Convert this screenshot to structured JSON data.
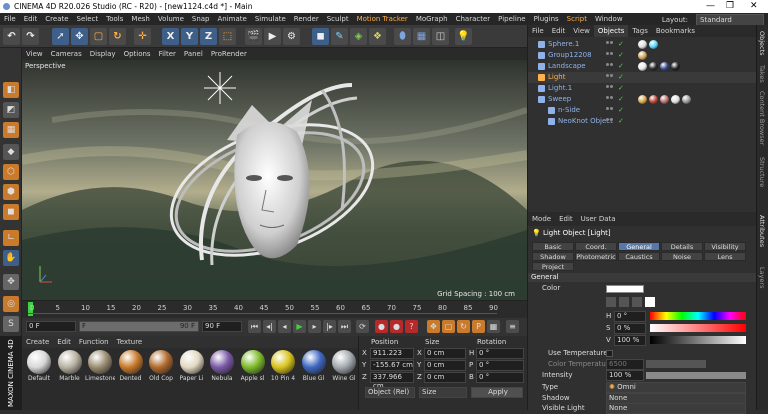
{
  "window": {
    "title": "CINEMA 4D R20.026 Studio (RC - R20) - [new1124.c4d *] - Main",
    "controls": [
      "—",
      "❐",
      "✕"
    ]
  },
  "menubar": {
    "items": [
      "File",
      "Edit",
      "Create",
      "Select",
      "Tools",
      "Mesh",
      "Volume",
      "Snap",
      "Animate",
      "Simulate",
      "Render",
      "Sculpt",
      "Motion Tracker",
      "MoGraph",
      "Character",
      "Pipeline",
      "Plugins",
      "Script",
      "Window"
    ],
    "highlighted": [
      "Motion Tracker",
      "Script"
    ],
    "layout_label": "Layout:",
    "layout_value": "Standard"
  },
  "toolbar": {
    "buttons": [
      "undo-icon",
      "redo-icon",
      "select-icon",
      "move-icon",
      "scale-icon",
      "rotate-icon",
      "cross-icon",
      "x-axis",
      "y-axis",
      "z-axis",
      "coord-icon",
      "render-view-icon",
      "render-icon",
      "render-settings-icon",
      "cube-icon",
      "pen-icon",
      "subdivision-icon",
      "array-icon",
      "deformer-icon",
      "scene-icon",
      "camera-icon",
      "light-icon"
    ],
    "axis_labels": [
      "X",
      "Y",
      "Z"
    ]
  },
  "viewport": {
    "menu": [
      "View",
      "Cameras",
      "Display",
      "Options",
      "Filter",
      "Panel",
      "ProRender"
    ],
    "camera": "Perspective",
    "grid_spacing": "Grid Spacing : 100 cm"
  },
  "timeline": {
    "ticks": [
      "0",
      "5",
      "10",
      "15",
      "20",
      "25",
      "30",
      "35",
      "40",
      "45",
      "50",
      "55",
      "60",
      "65",
      "70",
      "75",
      "80",
      "85",
      "90"
    ]
  },
  "transport": {
    "start_frame": "0 F",
    "current_frame": "F",
    "end_frame": "90 F",
    "max_frame": "90 F"
  },
  "materials": {
    "menu": [
      "Create",
      "Edit",
      "Function",
      "Texture"
    ],
    "items": [
      {
        "label": "Default",
        "color": "#d8d8d8"
      },
      {
        "label": "Marble",
        "color": "#b9b2a3"
      },
      {
        "label": "Limestone",
        "color": "#9b8d73"
      },
      {
        "label": "Dented",
        "color": "#c77a2a"
      },
      {
        "label": "Old Cop",
        "color": "#b06a2e"
      },
      {
        "label": "Paper Li",
        "color": "#e3d9c2"
      },
      {
        "label": "Nebula",
        "color": "#7b5aa6"
      },
      {
        "label": "Apple sl",
        "color": "#7dbb2a"
      },
      {
        "label": "10 Pin 4",
        "color": "#d8c31c"
      },
      {
        "label": "Blue Gl",
        "color": "#3f67c3"
      },
      {
        "label": "Wine Gl",
        "color": "#a4aab0"
      }
    ],
    "brand": "MAXON CINEMA 4D"
  },
  "coordinates": {
    "headers": [
      "Position",
      "Size",
      "Rotation"
    ],
    "rows": [
      {
        "axis": "X",
        "pos": "911.223 cm",
        "size_axis": "X",
        "size": "0 cm",
        "rot_axis": "H",
        "rot": "0 °"
      },
      {
        "axis": "Y",
        "pos": "-155.67 cm",
        "size_axis": "Y",
        "size": "0 cm",
        "rot_axis": "P",
        "rot": "0 °"
      },
      {
        "axis": "Z",
        "pos": "337.966 cm",
        "size_axis": "Z",
        "size": "0 cm",
        "rot_axis": "B",
        "rot": "0 °"
      }
    ],
    "mode": "Object (Rel)",
    "size_mode": "Size",
    "apply": "Apply"
  },
  "object_manager": {
    "menu": [
      "File",
      "Edit",
      "View",
      "Objects",
      "Tags",
      "Bookmarks"
    ],
    "active_tab": "Objects",
    "objects": [
      {
        "name": "Sphere.1",
        "color": "#8fb3e8",
        "icon": "sphere-icon",
        "indent": 0
      },
      {
        "name": "Group12208",
        "color": "#8fb3e8",
        "icon": "null-icon",
        "indent": 0
      },
      {
        "name": "Landscape",
        "color": "#8fb3e8",
        "icon": "landscape-icon",
        "indent": 0
      },
      {
        "name": "Light",
        "color": "#ffb04a",
        "icon": "light-icon",
        "indent": 0
      },
      {
        "name": "Light.1",
        "color": "#8fb3e8",
        "icon": "light-icon",
        "indent": 0
      },
      {
        "name": "Sweep",
        "color": "#8fb3e8",
        "icon": "sweep-icon",
        "indent": 0
      },
      {
        "name": "n-Side",
        "color": "#8fb3e8",
        "icon": "spline-icon",
        "indent": 1
      },
      {
        "name": "NeoKnot Object",
        "color": "#8fb3e8",
        "icon": "knot-icon",
        "indent": 1
      }
    ]
  },
  "attributes": {
    "menu": [
      "Mode",
      "Edit",
      "User Data"
    ],
    "object_title": "Light Object [Light]",
    "tabs": [
      "Basic",
      "Coord.",
      "General",
      "Details",
      "Visibility",
      "Shadow",
      "Photometric",
      "Caustics",
      "Noise",
      "Lens",
      "Project"
    ],
    "active_tab": "General",
    "section": "General",
    "color_label": "Color",
    "color_value": "#ffffff",
    "hsv": [
      {
        "label": "H",
        "value": "0 °"
      },
      {
        "label": "S",
        "value": "0 %"
      },
      {
        "label": "V",
        "value": "100 %"
      }
    ],
    "use_temperature": "Use Temperature",
    "color_temperature": "Color Temperature",
    "color_temperature_value": "6500",
    "intensity_label": "Intensity",
    "intensity_value": "100 %",
    "intensity_fraction": 1.0,
    "type_label": "Type",
    "type_value": "Omni",
    "shadow_label": "Shadow",
    "shadow_value": "None",
    "visible_light_label": "Visible Light",
    "visible_light_value": "None"
  },
  "side_tabs": [
    "Objects",
    "Takes",
    "Content Browser",
    "Structure",
    "Attributes",
    "Layers"
  ]
}
